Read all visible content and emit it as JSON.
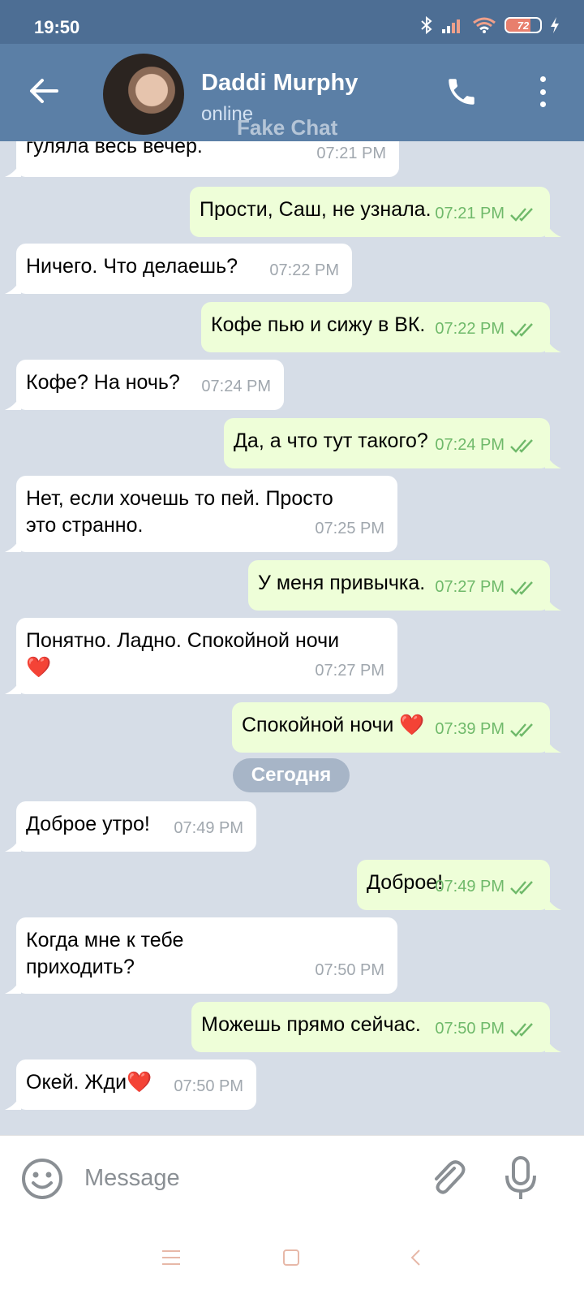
{
  "status_bar": {
    "time": "19:50",
    "battery": "72"
  },
  "header": {
    "name": "Daddi Murphy",
    "status": "online",
    "watermark": "Fake Chat"
  },
  "messages": [
    {
      "dir": "in",
      "text": "гуляла весь вечер.",
      "time": "07:21 PM"
    },
    {
      "dir": "out",
      "text": "Прости, Саш, не узнала.",
      "time": "07:21 PM"
    },
    {
      "dir": "in",
      "text": "Ничего. Что делаешь?",
      "time": "07:22 PM"
    },
    {
      "dir": "out",
      "text": "Кофе пью и сижу в ВК.",
      "time": "07:22 PM"
    },
    {
      "dir": "in",
      "text": "Кофе? На ночь?",
      "time": "07:24 PM"
    },
    {
      "dir": "out",
      "text": "Да, а что тут такого?",
      "time": "07:24 PM"
    },
    {
      "dir": "in",
      "text": "Нет, если хочешь то пей. Просто\nэто странно.",
      "time": "07:25 PM"
    },
    {
      "dir": "out",
      "text": "У меня привычка.",
      "time": "07:27 PM"
    },
    {
      "dir": "in",
      "text": "Понятно. Ладно. Спокойной ночи\n❤️",
      "time": "07:27 PM"
    },
    {
      "dir": "out",
      "text": "Спокойной ночи ❤️",
      "time": "07:39 PM"
    },
    {
      "dir": "in",
      "text": "Доброе утро!",
      "time": "07:49 PM"
    },
    {
      "dir": "out",
      "text": "Доброе!",
      "time": "07:49 PM"
    },
    {
      "dir": "in",
      "text": "Когда мне к тебе\nприходить?",
      "time": "07:50 PM"
    },
    {
      "dir": "out",
      "text": "Можешь прямо сейчас.",
      "time": "07:50 PM"
    },
    {
      "dir": "in",
      "text": "Окей. Жди❤️",
      "time": "07:50 PM"
    }
  ],
  "date_separator": "Сегодня",
  "input": {
    "placeholder": "Message",
    "value": ""
  },
  "colors": {
    "header": "#5b7fa6",
    "status_bar": "#4d6e94",
    "chat_bg": "#d6dde7",
    "outgoing_bubble": "#eefed8",
    "read_check": "#6fb96a"
  },
  "icons": [
    "back-arrow-icon",
    "phone-icon",
    "more-vert-icon",
    "emoji-icon",
    "attach-icon",
    "mic-icon",
    "bluetooth-icon",
    "signal-icon",
    "wifi-icon",
    "charging-icon"
  ]
}
